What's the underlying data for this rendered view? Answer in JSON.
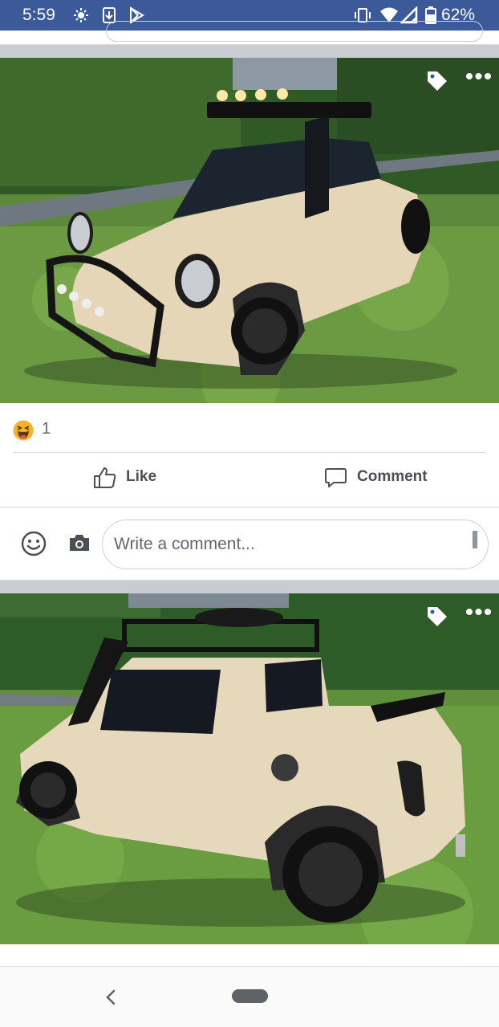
{
  "status_bar": {
    "time": "5:59",
    "battery_percent": "62%",
    "left_icons": [
      "brightness-icon",
      "download-icon",
      "play-store-icon"
    ],
    "right_icons": [
      "vibrate-icon",
      "wifi-icon",
      "signal-icon",
      "battery-icon"
    ],
    "background": "#3c5a99"
  },
  "post_1": {
    "photo_subject": "Cream Mini Cooper pickup conversion, front view with roof rack lights",
    "reactions": {
      "icon": "haha-emoji-icon",
      "count": "1"
    },
    "actions": {
      "like": "Like",
      "comment": "Comment"
    }
  },
  "comment_box": {
    "placeholder": "Write a comment..."
  },
  "post_2": {
    "photo_subject": "Cream Mini Cooper pickup conversion, rear side view with spoiler"
  },
  "nav_bar": {
    "back_icon": "back-chevron-icon",
    "home_icon": "home-pill-icon"
  }
}
